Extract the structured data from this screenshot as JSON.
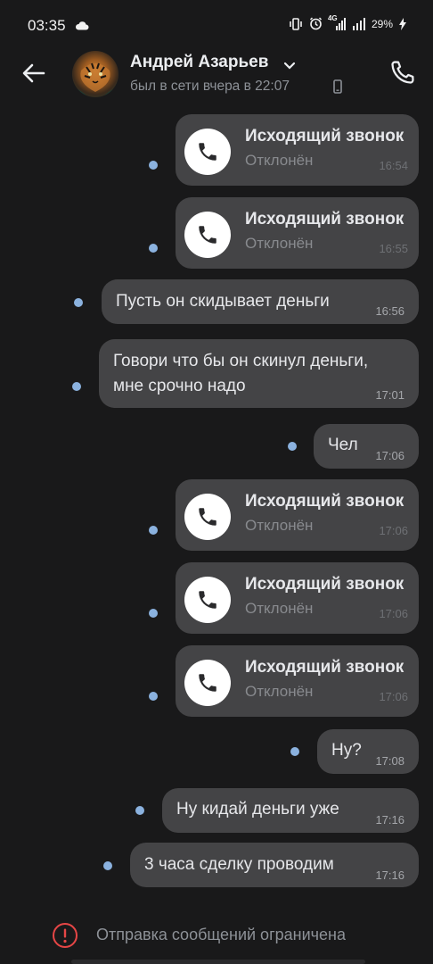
{
  "status_bar": {
    "time": "03:35",
    "network": "4G",
    "battery": "29%"
  },
  "header": {
    "name": "Андрей Азарьев",
    "last_seen": "был в сети вчера в 22:07"
  },
  "messages": [
    {
      "type": "call",
      "title": "Исходящий звонок",
      "status": "Отклонён",
      "time": "16:54"
    },
    {
      "type": "call",
      "title": "Исходящий звонок",
      "status": "Отклонён",
      "time": "16:55"
    },
    {
      "type": "text",
      "text": "Пусть он скидывает деньги",
      "time": "16:56"
    },
    {
      "type": "text",
      "line1": "Говори что бы он скинул деньги,",
      "line2": "мне срочно надо",
      "time": "17:01"
    },
    {
      "type": "text",
      "text": "Чел",
      "time": "17:06"
    },
    {
      "type": "call",
      "title": "Исходящий звонок",
      "status": "Отклонён",
      "time": "17:06"
    },
    {
      "type": "call",
      "title": "Исходящий звонок",
      "status": "Отклонён",
      "time": "17:06"
    },
    {
      "type": "call",
      "title": "Исходящий звонок",
      "status": "Отклонён",
      "time": "17:06"
    },
    {
      "type": "text",
      "text": "Ну?",
      "time": "17:08"
    },
    {
      "type": "text",
      "text": "Ну кидай деньги уже",
      "time": "17:16"
    },
    {
      "type": "text",
      "text": "3 часа сделку проводим",
      "time": "17:16"
    }
  ],
  "footer": {
    "restricted_text": "Отправка сообщений ограничена"
  },
  "colors": {
    "background": "#19191a",
    "bubble": "#444446",
    "unread_dot": "#8bb2df",
    "warning": "#e64646"
  },
  "icons": [
    "cloud-icon",
    "back-arrow-icon",
    "chevron-down-icon",
    "phone-icon",
    "call-icon",
    "warning-icon"
  ]
}
